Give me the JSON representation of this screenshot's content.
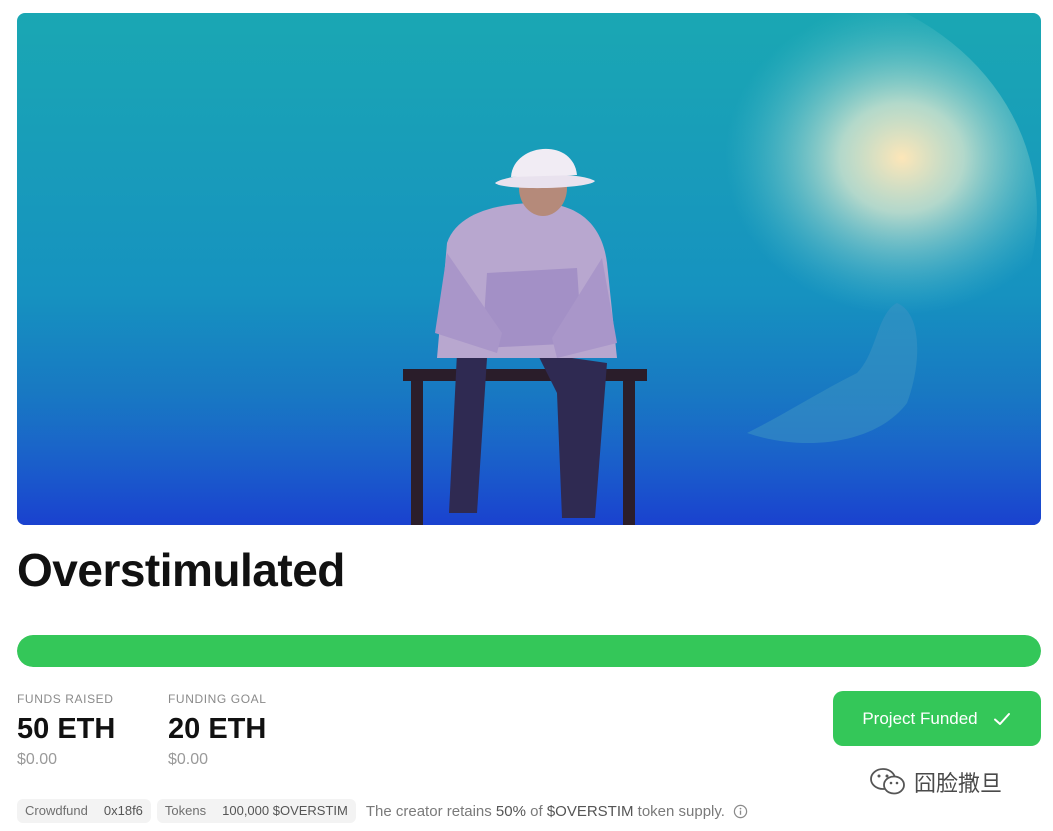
{
  "project": {
    "title": "Overstimulated"
  },
  "funding": {
    "progress_fraction": 1.0,
    "raised_label": "FUNDS RAISED",
    "raised_value": "50 ETH",
    "raised_usd": "$0.00",
    "goal_label": "FUNDING GOAL",
    "goal_value": "20 ETH",
    "goal_usd": "$0.00"
  },
  "status_button": {
    "label": "Project Funded",
    "icon": "checkmark-icon"
  },
  "meta": {
    "type_label": "Crowdfund",
    "address": "0x18f6",
    "tokens_label": "Tokens",
    "tokens_value": "100,000 $OVERSTIM",
    "retain_prefix": "The creator retains",
    "retain_pct": "50%",
    "retain_of": "of",
    "retain_token": "$OVERSTIM",
    "retain_suffix": "token supply.",
    "info_icon": "info-icon"
  },
  "watermark": {
    "text": "囧脸撒旦",
    "icon": "wechat-icon"
  },
  "colors": {
    "accent_green": "#34c759",
    "title_text": "#111111",
    "muted_text": "#8a8a8a"
  }
}
